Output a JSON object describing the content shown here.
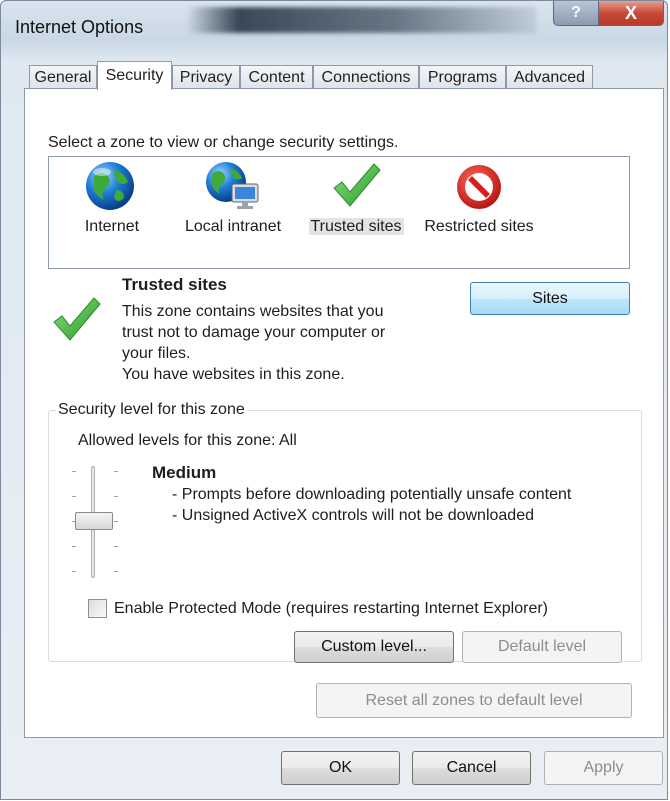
{
  "window": {
    "title": "Internet Options"
  },
  "titlebar_buttons": {
    "help": "?",
    "close": "X"
  },
  "tabs": [
    {
      "label": "General"
    },
    {
      "label": "Security",
      "active": true
    },
    {
      "label": "Privacy"
    },
    {
      "label": "Content"
    },
    {
      "label": "Connections"
    },
    {
      "label": "Programs"
    },
    {
      "label": "Advanced"
    }
  ],
  "security": {
    "zone_prompt": "Select a zone to view or change security settings.",
    "zones": [
      {
        "name": "Internet",
        "icon": "globe-icon"
      },
      {
        "name": "Local intranet",
        "icon": "intranet-globe-monitor-icon"
      },
      {
        "name": "Trusted sites",
        "icon": "green-checkmark-icon",
        "selected": true
      },
      {
        "name": "Restricted sites",
        "icon": "red-prohibited-icon"
      }
    ],
    "selected_zone": {
      "title": "Trusted sites",
      "description_lines": [
        "This zone contains websites that you",
        "trust not to damage your computer or",
        "your files.",
        "You have websites in this zone."
      ]
    },
    "sites_button": "Sites",
    "level_group": {
      "legend": "Security level for this zone",
      "allowed": "Allowed levels for this zone: All",
      "level_name": "Medium",
      "level_points": [
        "- Prompts before downloading potentially unsafe content",
        "- Unsigned ActiveX controls will not be downloaded"
      ],
      "protected_mode_label": "Enable Protected Mode (requires restarting Internet Explorer)",
      "protected_mode_checked": false,
      "custom_level_button": "Custom level...",
      "default_level_button": "Default level"
    },
    "reset_all_button": "Reset all zones to default level"
  },
  "dialog_buttons": {
    "ok": "OK",
    "cancel": "Cancel",
    "apply": "Apply"
  },
  "colors": {
    "accent_check": "#3cb34a",
    "prohibited_red": "#d81e1e",
    "sites_button_blue": "#bee6fd"
  }
}
